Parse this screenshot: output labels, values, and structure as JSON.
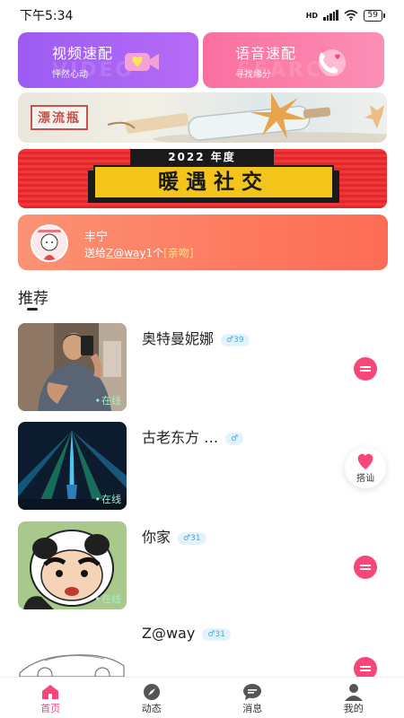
{
  "status_bar": {
    "time": "下午5:34",
    "battery": "59",
    "network": "HD"
  },
  "quick_actions": [
    {
      "title": "视频速配",
      "subtitle": "怦然心动",
      "watermark": "VIDEO",
      "icon": "video-camera-heart-icon"
    },
    {
      "title": "语音速配",
      "subtitle": "寻找缘分",
      "watermark": "SEARCH",
      "icon": "phone-heart-icon"
    }
  ],
  "bottle_banner": {
    "badge": "漂流瓶"
  },
  "event_banner": {
    "year": "2022 年度",
    "title": "暖遇社交"
  },
  "gift_feed": {
    "sender": "丰宁",
    "prefix": "送给",
    "recipient": "Z@way",
    "count": "1个",
    "item": "[亲吻]"
  },
  "section": {
    "title": "推荐"
  },
  "users": [
    {
      "name": "奥特曼妮娜",
      "gender_symbol": "♂",
      "age": "39",
      "online": "在线",
      "action": "chat"
    },
    {
      "name": "古老东方 …",
      "gender_symbol": "♂",
      "age": "",
      "online": "在线",
      "action": "hello",
      "action_label": "搭讪"
    },
    {
      "name": "你家",
      "gender_symbol": "♂",
      "age": "31",
      "online": "在线",
      "action": "chat"
    },
    {
      "name": "Z@way",
      "gender_symbol": "♂",
      "age": "31",
      "online": "",
      "action": "chat"
    }
  ],
  "tabbar": [
    {
      "label": "首页",
      "icon": "home-icon",
      "active": true
    },
    {
      "label": "动态",
      "icon": "compass-icon",
      "active": false
    },
    {
      "label": "消息",
      "icon": "message-icon",
      "active": false
    },
    {
      "label": "我的",
      "icon": "profile-icon",
      "active": false
    }
  ],
  "colors": {
    "accent": "#f8467a",
    "video_card": "#a560f4",
    "voice_card": "#fb7aa8",
    "gift_card": "#fd7a60",
    "event_red": "#e8292d",
    "event_yellow": "#f3c51a"
  }
}
